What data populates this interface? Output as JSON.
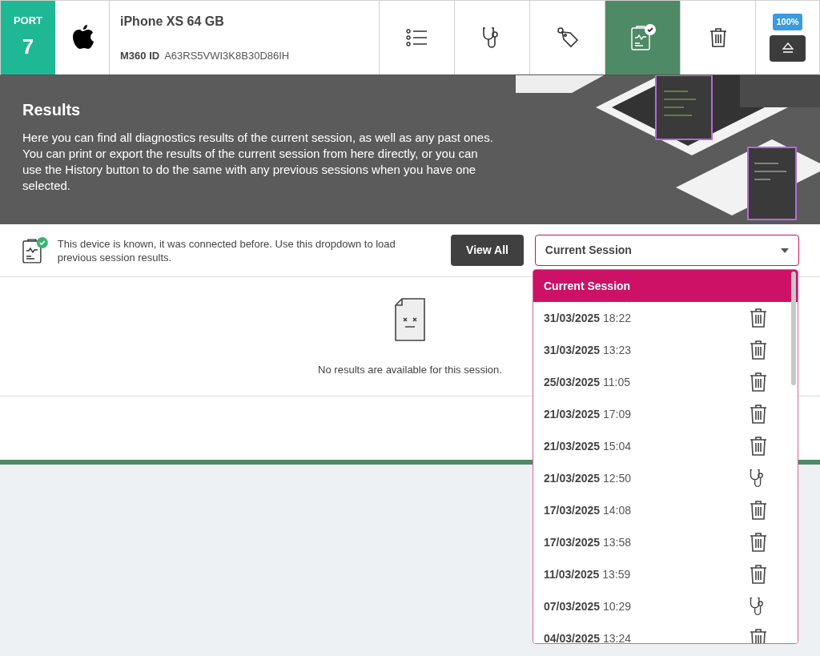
{
  "device": {
    "port_label": "PORT",
    "port_number": "7",
    "name": "iPhone XS 64 GB",
    "id_label": "M360 ID",
    "id_value": "A63RS5VWI3K8B30D86IH"
  },
  "toolbar": [
    {
      "kind": "list",
      "selected": false
    },
    {
      "kind": "diagnostics",
      "selected": false
    },
    {
      "kind": "tag",
      "selected": false
    },
    {
      "kind": "results",
      "selected": true
    },
    {
      "kind": "delete",
      "selected": false
    }
  ],
  "battery": "100%",
  "banner": {
    "title": "Results",
    "text": "Here you can find all diagnostics results of the current session, as well as any past ones. You can print or export the results of the current session from here directly, or you can use the History button to do the same with any previous sessions when you have one selected."
  },
  "info": {
    "text": "This device is known, it was connected before. Use this dropdown to load previous session results.",
    "view_all": "View All",
    "dropdown_value": "Current Session"
  },
  "empty": {
    "message": "No results are available for this session."
  },
  "dropdown_options": [
    {
      "label": "Current Session",
      "selected": true
    },
    {
      "date": "31/03/2025",
      "time": "18:22",
      "kind": "delete",
      "selected": false
    },
    {
      "date": "31/03/2025",
      "time": "13:23",
      "kind": "delete",
      "selected": false
    },
    {
      "date": "25/03/2025",
      "time": "11:05",
      "kind": "delete",
      "selected": false
    },
    {
      "date": "21/03/2025",
      "time": "17:09",
      "kind": "delete",
      "selected": false
    },
    {
      "date": "21/03/2025",
      "time": "15:04",
      "kind": "delete",
      "selected": false
    },
    {
      "date": "21/03/2025",
      "time": "12:50",
      "kind": "diagnostics",
      "selected": false
    },
    {
      "date": "17/03/2025",
      "time": "14:08",
      "kind": "delete",
      "selected": false
    },
    {
      "date": "17/03/2025",
      "time": "13:58",
      "kind": "delete",
      "selected": false
    },
    {
      "date": "11/03/2025",
      "time": "13:59",
      "kind": "delete",
      "selected": false
    },
    {
      "date": "07/03/2025",
      "time": "10:29",
      "kind": "diagnostics",
      "selected": false
    },
    {
      "date": "04/03/2025",
      "time": "13:24",
      "kind": "delete",
      "selected": false
    }
  ]
}
